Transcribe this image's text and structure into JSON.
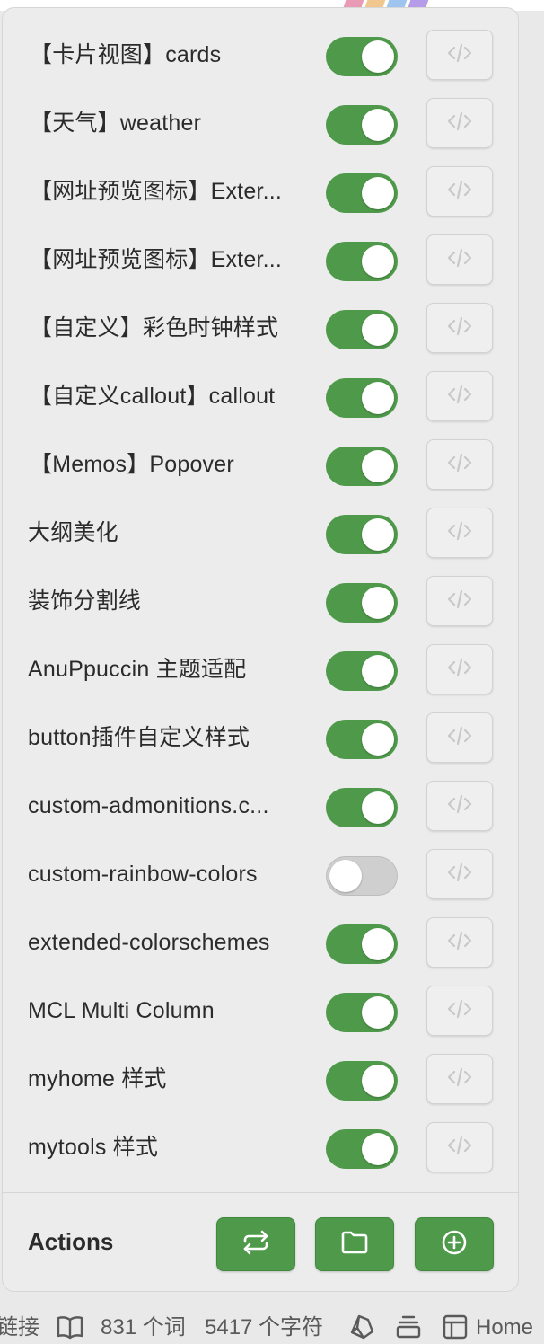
{
  "colors": {
    "toggle_on": "#4e9a4a",
    "toggle_off": "#cfcfcf",
    "action_button": "#4e9a4a"
  },
  "snippets": [
    {
      "label": "【卡片视图】cards",
      "enabled": true
    },
    {
      "label": "【天气】weather",
      "enabled": true
    },
    {
      "label": "【网址预览图标】Exter...",
      "enabled": true
    },
    {
      "label": "【网址预览图标】Exter...",
      "enabled": true
    },
    {
      "label": "【自定义】彩色时钟样式",
      "enabled": true
    },
    {
      "label": "【自定义callout】callout",
      "enabled": true
    },
    {
      "label": "【Memos】Popover",
      "enabled": true
    },
    {
      "label": "大纲美化",
      "enabled": true
    },
    {
      "label": "装饰分割线",
      "enabled": true
    },
    {
      "label": "AnuPpuccin 主题适配",
      "enabled": true
    },
    {
      "label": "button插件自定义样式",
      "enabled": true
    },
    {
      "label": "custom-admonitions.c...",
      "enabled": true
    },
    {
      "label": "custom-rainbow-colors",
      "enabled": false
    },
    {
      "label": "extended-colorschemes",
      "enabled": true
    },
    {
      "label": "MCL Multi Column",
      "enabled": true
    },
    {
      "label": "myhome 样式",
      "enabled": true
    },
    {
      "label": "mytools 样式",
      "enabled": true
    }
  ],
  "actions": {
    "label": "Actions",
    "buttons": [
      {
        "icon": "repeat-icon"
      },
      {
        "icon": "folder-icon"
      },
      {
        "icon": "plus-circle-icon"
      }
    ]
  },
  "status_bar": {
    "links_text": "链接",
    "words": "831 个词",
    "chars": "5417 个字符",
    "home": "Home"
  }
}
